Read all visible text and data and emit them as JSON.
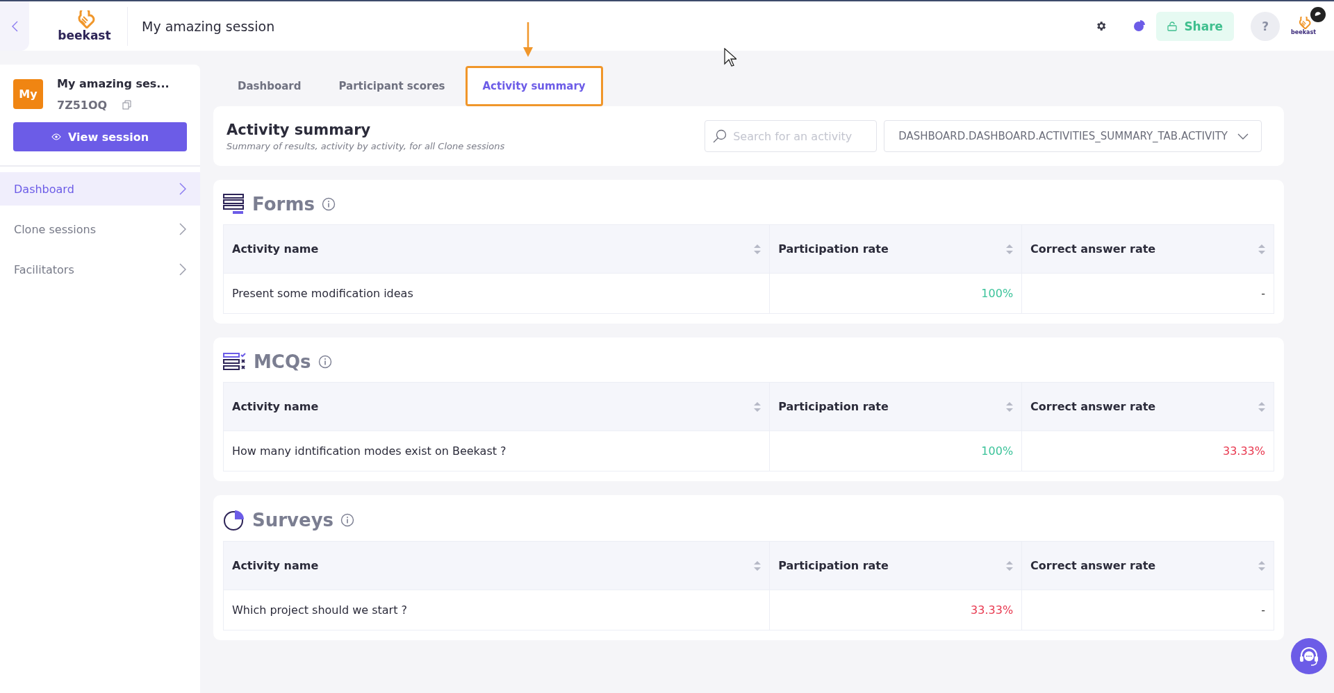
{
  "topbar": {
    "logo_text": "beekast",
    "title": "My amazing session",
    "share_label": "Share",
    "help_label": "?",
    "corner_logo_text": "beekast"
  },
  "sidebar": {
    "avatar": "My",
    "session_name": "My amazing ses...",
    "session_code": "7Z51OQ",
    "view_button": "View session",
    "items": [
      {
        "label": "Dashboard",
        "selected": true
      },
      {
        "label": "Clone sessions",
        "selected": false
      },
      {
        "label": "Facilitators",
        "selected": false
      }
    ]
  },
  "tabs": [
    {
      "label": "Dashboard",
      "selected": false,
      "highlighted": false
    },
    {
      "label": "Participant scores",
      "selected": false,
      "highlighted": false
    },
    {
      "label": "Activity summary",
      "selected": true,
      "highlighted": true
    }
  ],
  "header": {
    "title": "Activity summary",
    "subtitle": "Summary of results, activity by activity, for all Clone sessions",
    "search": {
      "placeholder": "Search for an activity"
    },
    "filter": "DASHBOARD.DASHBOARD.ACTIVITIES_SUMMARY_TAB.ACTIVITY"
  },
  "sections": [
    {
      "kind": "forms",
      "title": "Forms",
      "columns": [
        "Activity name",
        "Participation rate",
        "Correct answer rate"
      ],
      "rows": [
        {
          "name": "Present some modification ideas",
          "participation": {
            "text": "100%",
            "color": "#3cc39a"
          },
          "correct": {
            "text": "-",
            "color": "#333333"
          }
        }
      ]
    },
    {
      "kind": "mcqs",
      "title": "MCQs",
      "columns": [
        "Activity name",
        "Participation rate",
        "Correct answer rate"
      ],
      "rows": [
        {
          "name": "How many idntification modes exist on Beekast ?",
          "participation": {
            "text": "100%",
            "color": "#3cc39a"
          },
          "correct": {
            "text": "33.33%",
            "color": "#e8384f"
          }
        }
      ]
    },
    {
      "kind": "surveys",
      "title": "Surveys",
      "columns": [
        "Activity name",
        "Participation rate",
        "Correct answer rate"
      ],
      "rows": [
        {
          "name": "Which project should we start ?",
          "participation": {
            "text": "33.33%",
            "color": "#e8384f"
          },
          "correct": {
            "text": "-",
            "color": "#333333"
          }
        }
      ]
    }
  ]
}
